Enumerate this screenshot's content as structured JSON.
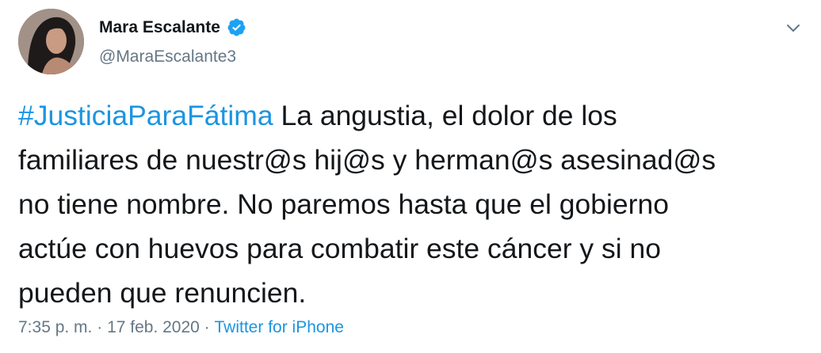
{
  "author": {
    "display_name": "Mara Escalante",
    "handle": "@MaraEscalante3",
    "verified": true
  },
  "tweet": {
    "hashtag": "#JusticiaParaFátima",
    "lines": [
      " La angustia, el dolor de los",
      "familiares de nuestr@s hij@s y herman@s asesinad@s",
      "no tiene nombre. No paremos hasta que el gobierno",
      "actúe con huevos para combatir este cáncer y si no",
      "pueden que renuncien."
    ]
  },
  "meta": {
    "time": "7:35 p. m.",
    "separator": " · ",
    "date": "17 feb. 2020",
    "source": "Twitter for iPhone"
  },
  "colors": {
    "link": "#1b95e0",
    "text": "#14171a",
    "muted": "#657786",
    "verified_badge": "#1da1f2"
  },
  "icons": {
    "verified": "verified-badge-icon",
    "menu": "chevron-down-icon"
  }
}
